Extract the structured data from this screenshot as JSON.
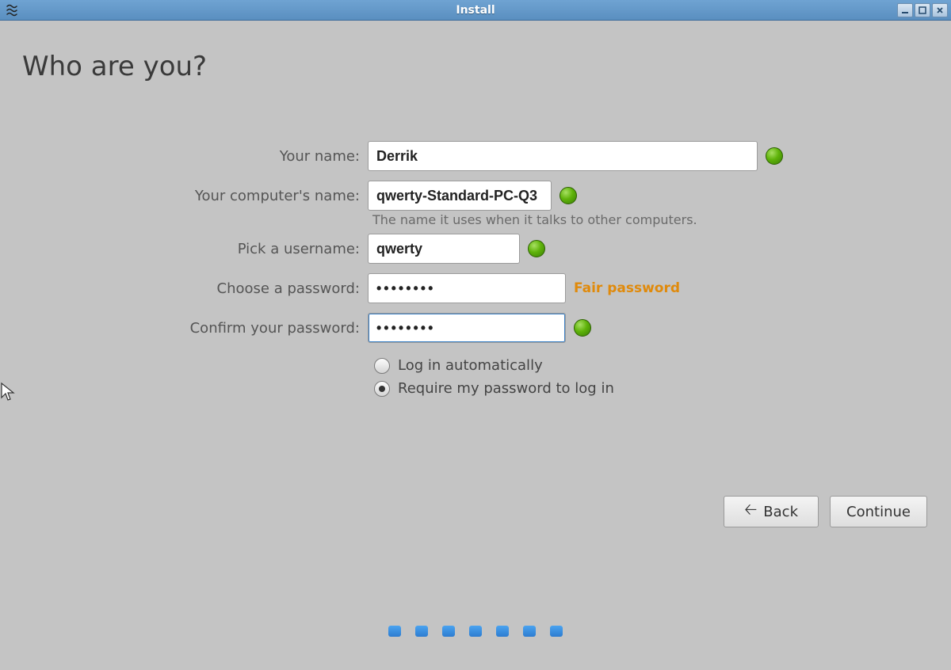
{
  "window": {
    "title": "Install"
  },
  "heading": "Who are you?",
  "form": {
    "name_label": "Your name:",
    "name_value": "Derrik",
    "hostname_label": "Your computer's name:",
    "hostname_value": "qwerty-Standard-PC-Q3",
    "hostname_helper": "The name it uses when it talks to other computers.",
    "username_label": "Pick a username:",
    "username_value": "qwerty",
    "password_label": "Choose a password:",
    "password_value": "••••••••",
    "password_strength": "Fair password",
    "confirm_label": "Confirm your password:",
    "confirm_value": "••••••••",
    "auto_login_label": "Log in automatically",
    "require_password_label": "Require my password to log in"
  },
  "buttons": {
    "back": "Back",
    "continue": "Continue"
  }
}
